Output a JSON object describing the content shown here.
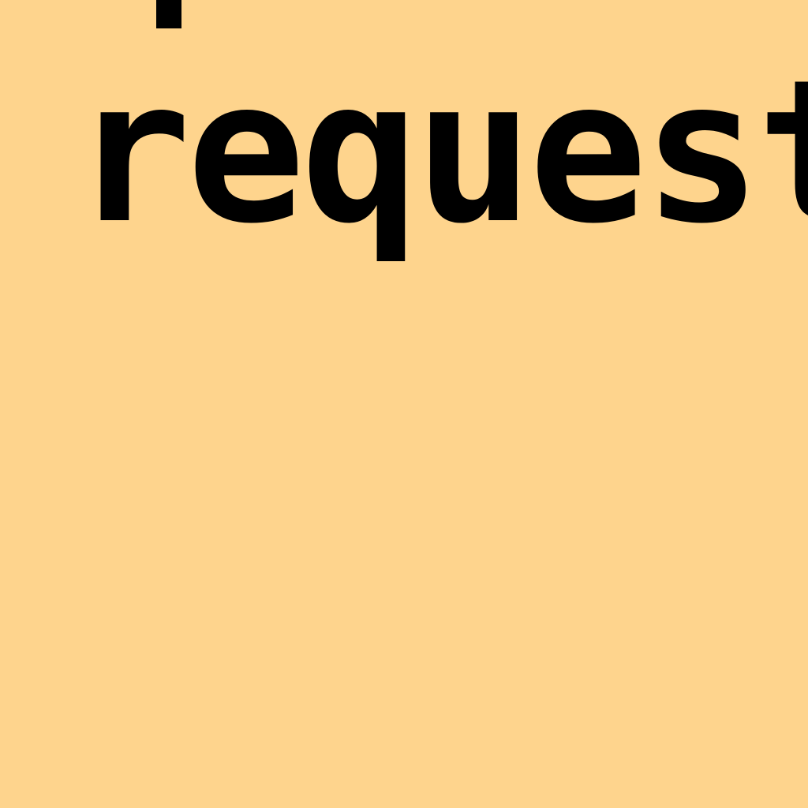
{
  "document": {
    "visible_word": "request"
  },
  "colors": {
    "background": "#FED48D",
    "text": "#000000"
  }
}
